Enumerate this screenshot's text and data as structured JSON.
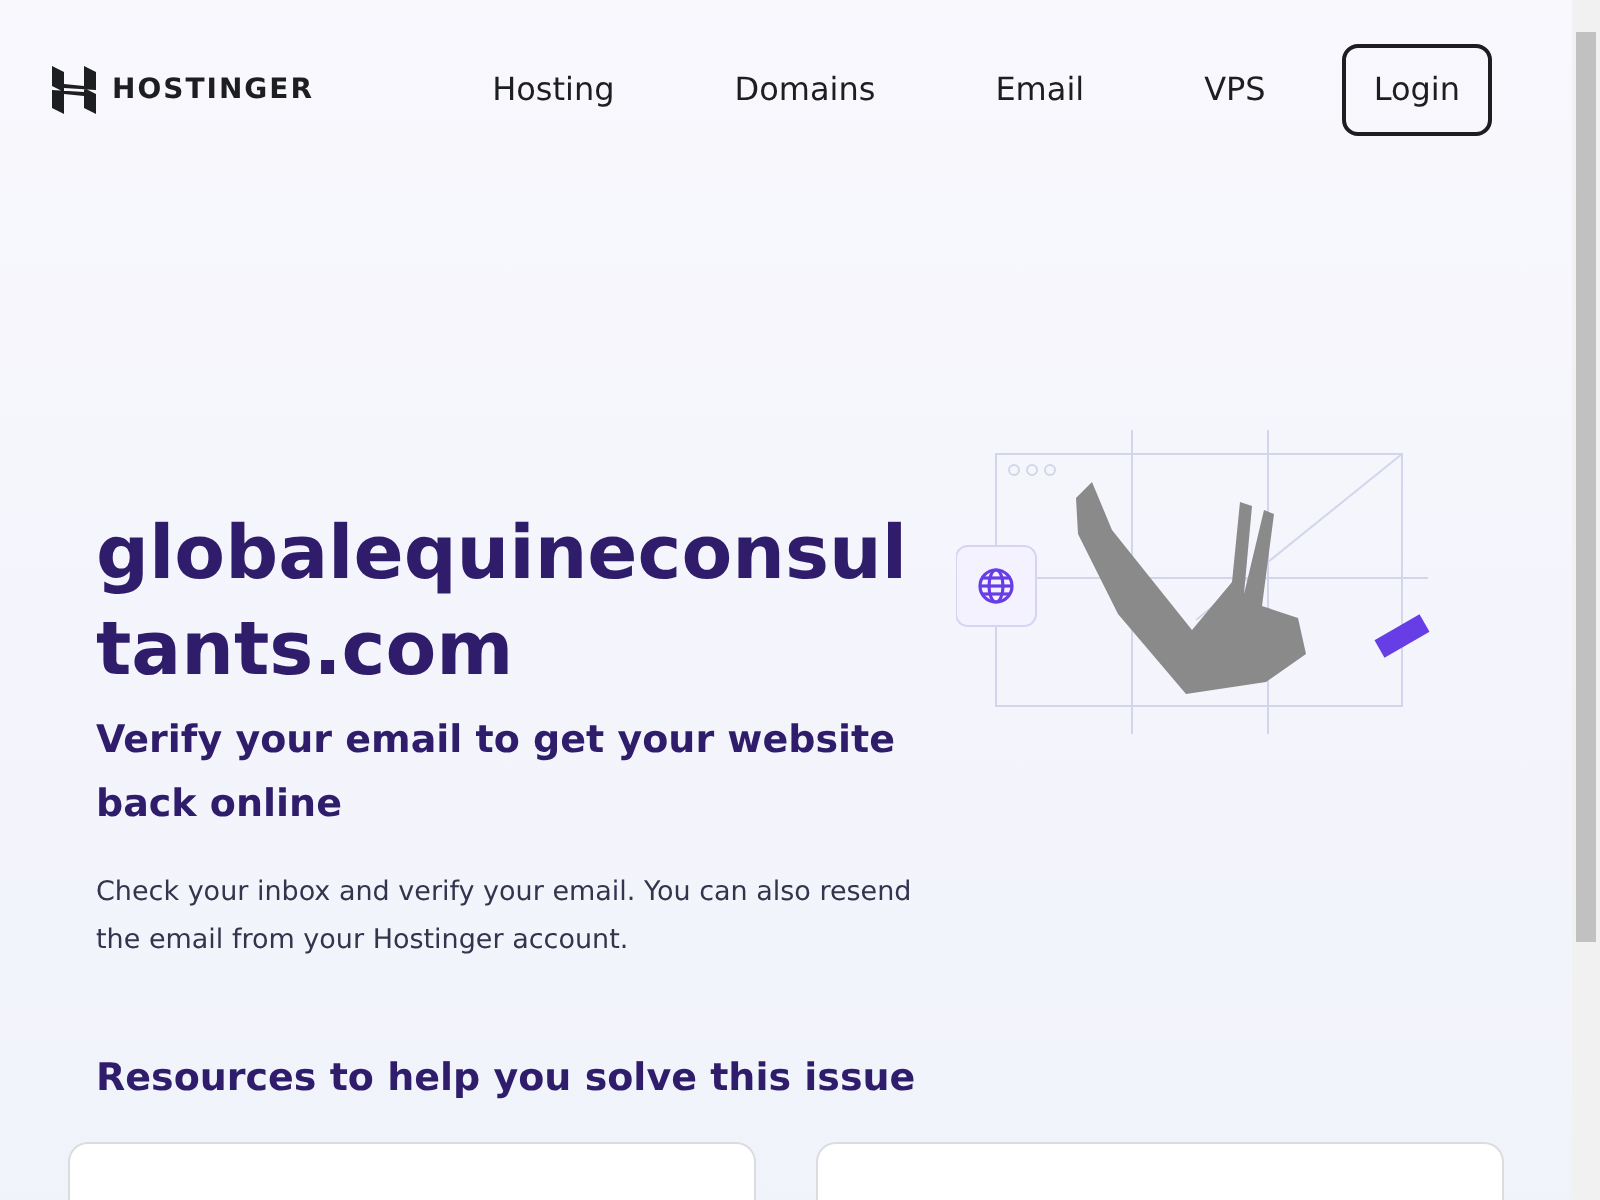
{
  "header": {
    "logo_text": "HOSTINGER",
    "nav": [
      {
        "label": "Hosting"
      },
      {
        "label": "Domains"
      },
      {
        "label": "Email"
      },
      {
        "label": "VPS"
      }
    ],
    "login": "Login"
  },
  "hero": {
    "domain": "globalequineconsultants.com",
    "heading": "Verify your email to get your website back online",
    "text": "Check your inbox and verify your email. You can also resend the email from your Hostinger account."
  },
  "resources": {
    "title": "Resources to help you solve this issue"
  }
}
